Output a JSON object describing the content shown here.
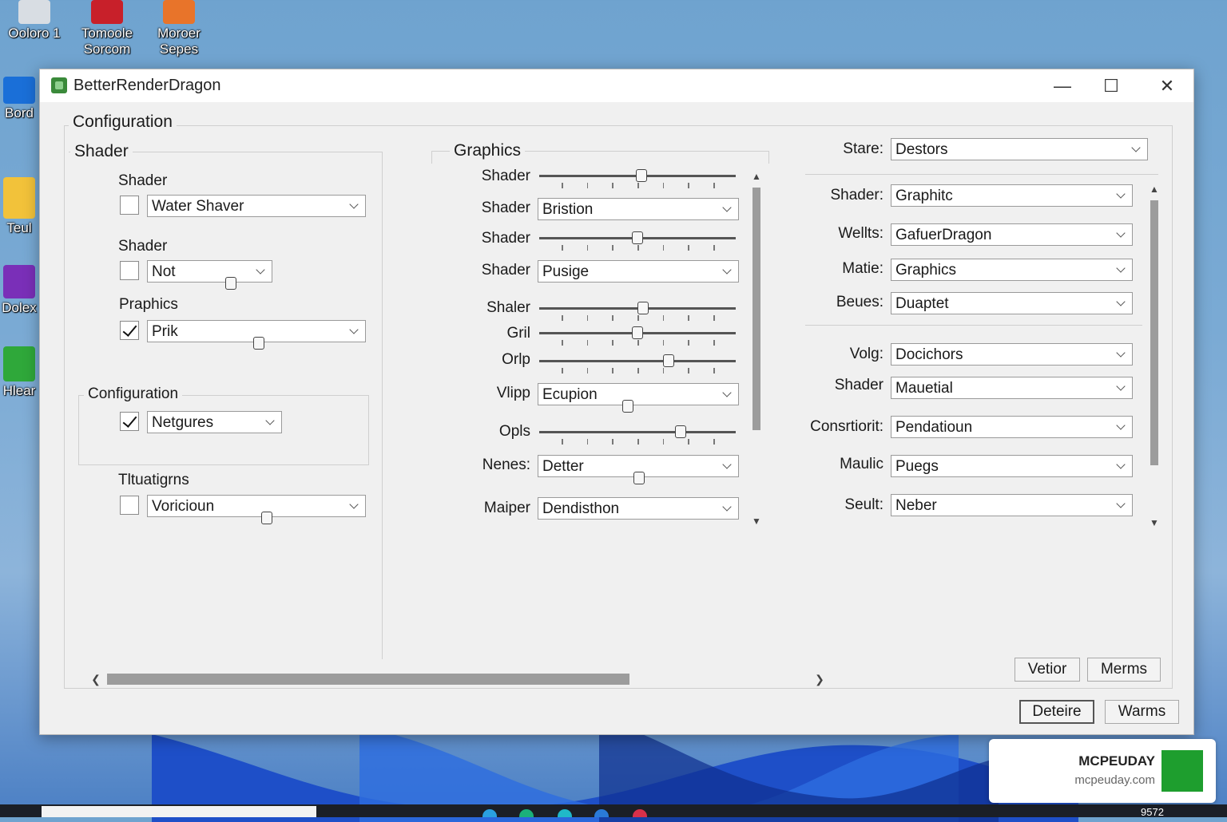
{
  "desktop": {
    "icons": [
      {
        "label_line1": "Ooloro 1",
        "label_line2": ""
      },
      {
        "label_line1": "Tomoole",
        "label_line2": "Sorcom"
      },
      {
        "label_line1": "Moroer",
        "label_line2": "Sepes"
      },
      {
        "label_line1": "Bord",
        "label_line2": ""
      },
      {
        "label_line1": "Teul",
        "label_line2": ""
      },
      {
        "label_line1": "Dolex",
        "label_line2": ""
      },
      {
        "label_line1": "Hlear",
        "label_line2": ""
      }
    ]
  },
  "window": {
    "title": "BetterRenderDragon",
    "configuration_label": "Configuration",
    "shader_panel": {
      "legend": "Shader",
      "rows": [
        {
          "label": "Shader",
          "checked": false,
          "value": "Water Shaver"
        },
        {
          "label": "Shader",
          "checked": false,
          "value": "Not"
        },
        {
          "label": "Praphics",
          "checked": true,
          "value": "Prik"
        }
      ],
      "config_group": {
        "legend": "Configuration",
        "checked": true,
        "value": "Netgures"
      },
      "last_row": {
        "label": "Tltuatigrns",
        "checked": false,
        "value": "Voricioun"
      }
    },
    "graphics_panel": {
      "legend": "Graphics",
      "rows": [
        {
          "label": "Shader",
          "type": "slider",
          "level": 0.52
        },
        {
          "label": "Shader",
          "type": "combo",
          "value": "Bristion"
        },
        {
          "label": "Shader",
          "type": "slider",
          "level": 0.5
        },
        {
          "label": "Shader",
          "type": "combo",
          "value": "Pusige"
        },
        {
          "label": "Shaler",
          "type": "slider",
          "level": 0.53
        },
        {
          "label": "Gril",
          "type": "slider",
          "level": 0.5
        },
        {
          "label": "Orlp",
          "type": "slider",
          "level": 0.66
        },
        {
          "label": "Vlipp",
          "type": "combo",
          "value": "Ecupion"
        },
        {
          "label": "Opls",
          "type": "slider",
          "level": 0.72
        },
        {
          "label": "Nenes:",
          "type": "combo",
          "value": "Detter"
        },
        {
          "label": "Maiper",
          "type": "combo",
          "value": "Dendisthon"
        }
      ]
    },
    "right_panel": {
      "state_label": "Stare:",
      "state_value": "Destors",
      "rows": [
        {
          "label": "Shader:",
          "value": "Graphitc"
        },
        {
          "label": "Wellts:",
          "value": "GafuerDragon"
        },
        {
          "label": "Matie:",
          "value": "Graphics"
        },
        {
          "label": "Beues:",
          "value": "Duaptet"
        },
        {
          "label": "Volg:",
          "value": "Docichors"
        },
        {
          "label": "Shader",
          "value": "Mauetial"
        },
        {
          "label": "Consrtiorit:",
          "value": "Pendatioun"
        },
        {
          "label": "Maulic",
          "value": "Puegs"
        },
        {
          "label": "Seult:",
          "value": "Neber"
        }
      ]
    },
    "inner_buttons": {
      "left": "Vetior",
      "right": "Merms"
    },
    "footer_buttons": {
      "primary": "Deteire",
      "secondary": "Warms"
    }
  },
  "taskbar": {
    "clock": "9572"
  },
  "watermark": {
    "brand": "MCPEUDAY",
    "site": "mcpeuday.com"
  },
  "colors": {
    "accent": "#3a8a3a",
    "window_bg": "#f0f0f0",
    "scroll_thumb": "#9c9c9c"
  }
}
